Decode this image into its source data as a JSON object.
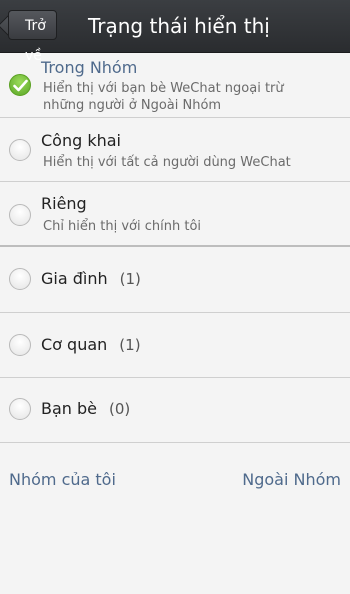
{
  "header": {
    "back_label": "Trở về",
    "title": "Trạng thái hiển thị"
  },
  "options": [
    {
      "title": "Trong Nhóm",
      "desc_line1": "Hiển thị với bạn bè WeChat ngoại trừ",
      "desc_line2": "những người ở Ngoài Nhóm",
      "selected": true
    },
    {
      "title": "Công khai",
      "desc_line1": "Hiển thị với tất cả người dùng WeChat",
      "selected": false
    },
    {
      "title": "Riêng",
      "desc_line1": "Chỉ hiển thị với chính tôi",
      "selected": false
    }
  ],
  "groups": [
    {
      "label": "Gia đình",
      "count": "(1)"
    },
    {
      "label": "Cơ quan",
      "count": "(1)"
    },
    {
      "label": "Bạn bè",
      "count": "(0)"
    }
  ],
  "footer": {
    "my_groups": "Nhóm của tôi",
    "outside_groups": "Ngoài Nhóm"
  },
  "colors": {
    "header_bg": "#2f3135",
    "selected_text": "#4f6a8c",
    "checkmark_green": "#6dba32",
    "background": "#f4f4f4"
  }
}
